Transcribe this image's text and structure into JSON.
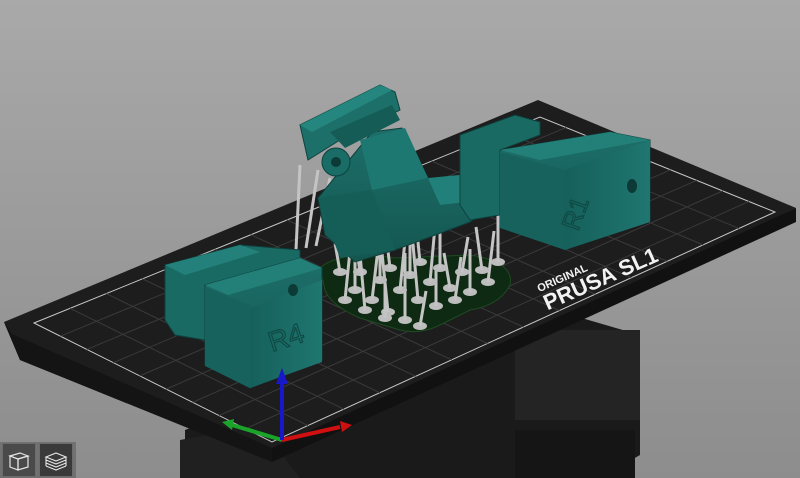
{
  "bed": {
    "brand_line": "ORIGINAL",
    "model_line": "PRUSA SL1"
  },
  "parts": {
    "left_block_emboss": "R4",
    "right_block_emboss": "R1"
  },
  "view_toolbar": {
    "buttons": [
      {
        "icon": "iso-view-cube-icon"
      },
      {
        "icon": "layers-view-icon"
      }
    ]
  },
  "colors": {
    "background": "#a3a3a3",
    "bed": "#1c1c1c",
    "grid": "#3b3b3b",
    "model": "#1e6b66",
    "supports": "#bdbdbd",
    "pad": "#0f2a12",
    "axis_x": "#d01010",
    "axis_y": "#1aa52a",
    "axis_z": "#1818c8"
  }
}
